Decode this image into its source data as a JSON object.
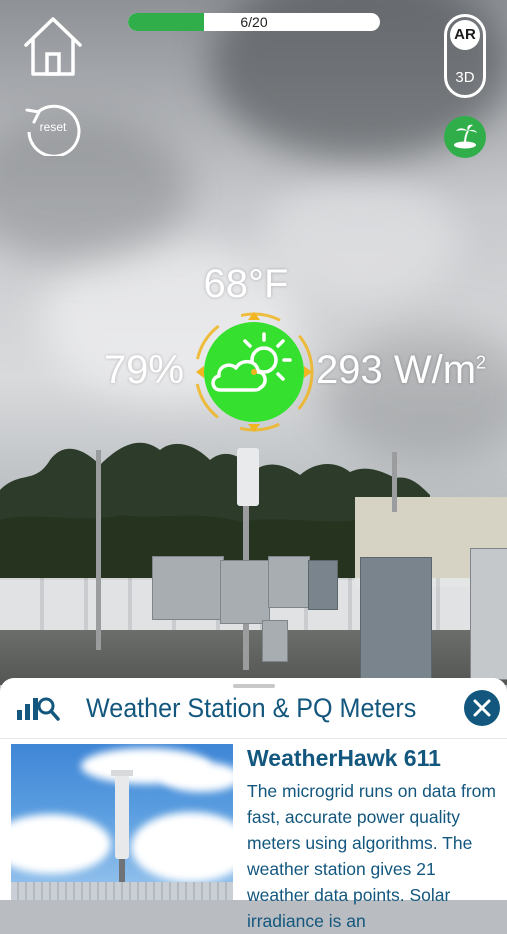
{
  "progress": {
    "text": "6/20",
    "fraction": 0.3
  },
  "hud": {
    "reset_label": "reset",
    "mode_ar": "AR",
    "mode_3d": "3D"
  },
  "icons": {
    "home": "home-icon",
    "reset": "reset-icon",
    "island": "island-icon",
    "weather": "partly-sunny-icon",
    "stats": "bar-chart-search-icon",
    "close": "close-icon"
  },
  "weather": {
    "temperature": "68°F",
    "humidity": "79%",
    "irradiance": "293 W/m",
    "irradiance_exp": "2"
  },
  "panel": {
    "title": "Weather Station & PQ Meters",
    "device_title": "WeatherHawk 611",
    "description": "The microgrid runs on data from fast, accurate power quality meters using algorithms. The weather station gives 21 weather data points. Solar irradiance is an"
  },
  "colors": {
    "accent_green": "#2fae4a",
    "brand_blue": "#13577e",
    "dial_green": "#35e02f",
    "dial_ring": "#f0b51f"
  }
}
